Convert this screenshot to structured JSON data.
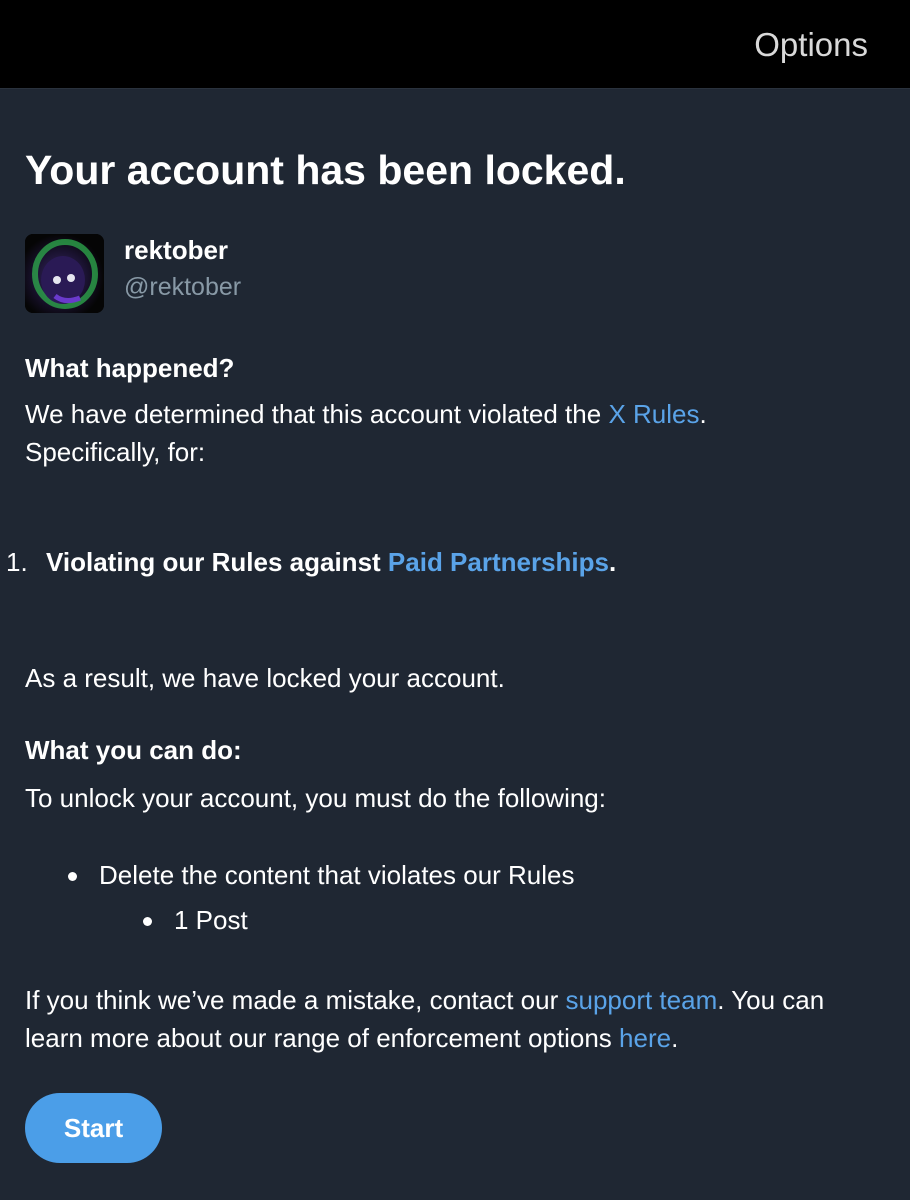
{
  "header": {
    "options_label": "Options"
  },
  "title": "Your account has been locked.",
  "account": {
    "display_name": "rektober",
    "handle": "@rektober"
  },
  "what_happened": {
    "heading": "What happened?",
    "text_before_link": "We have determined that this account violated the ",
    "link": "X Rules",
    "text_after_link": ".",
    "line2": "Specifically, for:"
  },
  "violations": [
    {
      "number": "1.",
      "text": "Violating our Rules against ",
      "link": "Paid Partnerships",
      "suffix": "."
    }
  ],
  "result_text": "As a result, we have locked your account.",
  "what_you_can_do": {
    "heading": "What you can do:",
    "text": "To unlock your account, you must do the following:",
    "bullet": "Delete the content that violates our Rules",
    "sub_bullet": "1 Post"
  },
  "mistake": {
    "text_before_link": "If you think we’ve made a mistake, contact our ",
    "link1": "support team",
    "text_middle": ". You can learn more about our range of enforcement options ",
    "link2": "here",
    "text_end": "."
  },
  "start_label": "Start",
  "colors": {
    "background": "#1f2733",
    "topbar": "#000000",
    "link": "#5aa3e8",
    "button": "#4b9ee8",
    "muted": "#8899a6"
  }
}
